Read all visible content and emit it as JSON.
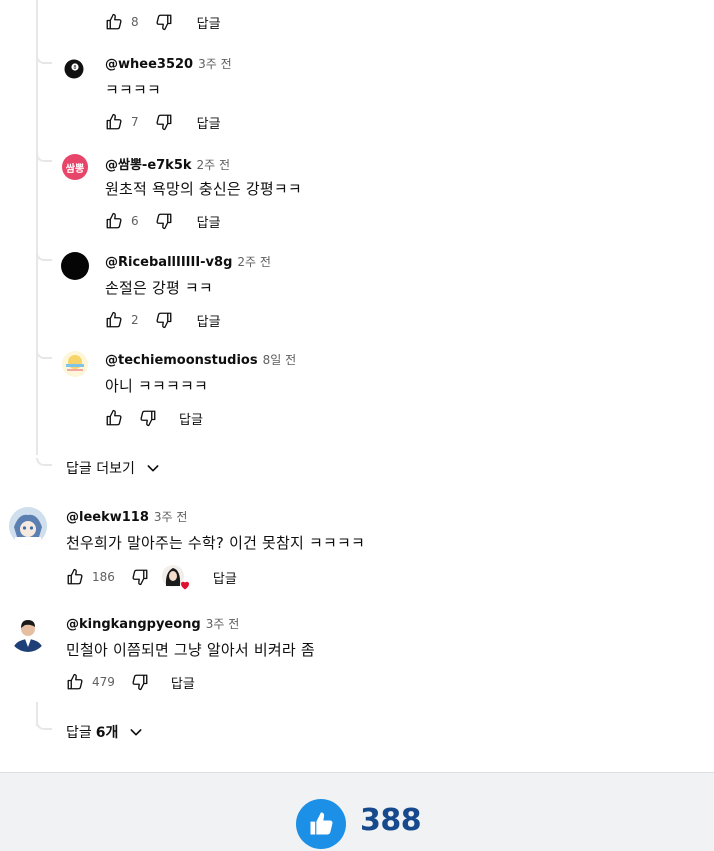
{
  "replies": [
    {
      "likes": "8",
      "reply_label": "답글"
    },
    {
      "handle": "@whee3520",
      "time": "3주 전",
      "text": "ㅋㅋㅋㅋ",
      "likes": "7",
      "reply_label": "답글"
    },
    {
      "handle": "@쌈뽕-e7k5k",
      "time": "2주 전",
      "text": "원초적 욕망의 충신은 강평ㅋㅋ",
      "likes": "6",
      "reply_label": "답글",
      "avatar_text": "쌈뽕",
      "avatar_color": "#e8456b"
    },
    {
      "handle": "@RiceballIIIII-v8g",
      "time": "2주 전",
      "text": "손절은 강평 ㅋㅋ",
      "likes": "2",
      "reply_label": "답글"
    },
    {
      "handle": "@techiemoonstudios",
      "time": "8일 전",
      "text": "아니 ㅋㅋㅋㅋㅋ",
      "reply_label": "답글"
    }
  ],
  "more_replies_label": "답글 더보기",
  "comments": [
    {
      "handle": "@leekw118",
      "time": "3주 전",
      "text": "천우희가 말아주는 수학? 이건 못참지 ㅋㅋㅋㅋ",
      "likes": "186",
      "reply_label": "답글"
    },
    {
      "handle": "@kingkangpyeong",
      "time": "3주 전",
      "text": "민철아 이쯤되면 그냥 알아서 비켜라 좀",
      "likes": "479",
      "reply_label": "답글"
    }
  ],
  "replies_toggle": {
    "label": "답글",
    "count": "6개"
  },
  "footer": {
    "like_count": "388",
    "like_color": "#1c8fe6"
  }
}
